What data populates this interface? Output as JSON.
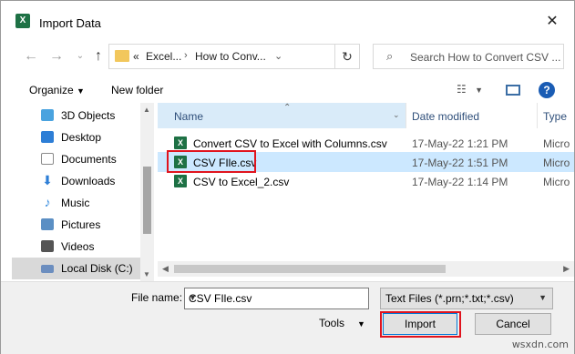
{
  "window": {
    "title": "Import Data",
    "app_icon": "excel-icon"
  },
  "address": {
    "crumbs": [
      "«",
      "Excel...",
      "How to Conv..."
    ],
    "search_placeholder": "Search How to Convert CSV ..."
  },
  "toolbar": {
    "organize": "Organize",
    "new_folder": "New folder"
  },
  "nav": {
    "items": [
      {
        "label": "3D Objects",
        "icon": "3d-objects-icon",
        "color": "#4aa3df"
      },
      {
        "label": "Desktop",
        "icon": "desktop-icon",
        "color": "#2d7ed6"
      },
      {
        "label": "Documents",
        "icon": "documents-icon",
        "color": "#8a8a8a"
      },
      {
        "label": "Downloads",
        "icon": "downloads-icon",
        "color": "#2d7ed6"
      },
      {
        "label": "Music",
        "icon": "music-icon",
        "color": "#3a8ee0"
      },
      {
        "label": "Pictures",
        "icon": "pictures-icon",
        "color": "#5b8fc4"
      },
      {
        "label": "Videos",
        "icon": "videos-icon",
        "color": "#555555"
      },
      {
        "label": "Local Disk (C:)",
        "icon": "local-disk-icon",
        "color": "#6c8ebf"
      }
    ],
    "selected_index": 7
  },
  "columns": {
    "name": "Name",
    "date": "Date modified",
    "type": "Type"
  },
  "files": [
    {
      "name": "Convert CSV to Excel with Columns.csv",
      "date": "17-May-22 1:21 PM",
      "type": "Micro"
    },
    {
      "name": "CSV FIle.csv",
      "date": "17-May-22 1:51 PM",
      "type": "Micro"
    },
    {
      "name": "CSV to Excel_2.csv",
      "date": "17-May-22 1:14 PM",
      "type": "Micro"
    }
  ],
  "selected_file_index": 1,
  "bottom": {
    "file_name_label": "File name:",
    "file_name_value": "CSV FIle.csv",
    "file_type": "Text Files (*.prn;*.txt;*.csv)",
    "tools": "Tools",
    "import": "Import",
    "cancel": "Cancel"
  },
  "watermark": "wsxdn.com",
  "colors": {
    "highlight": "#e0141e",
    "selection": "#cce8ff",
    "header": "#d9ebf9"
  }
}
